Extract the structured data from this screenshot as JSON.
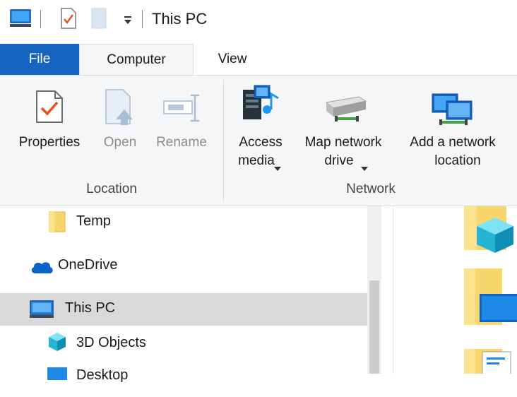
{
  "window": {
    "title": "This PC"
  },
  "quick_access": {
    "icons": [
      "computer-icon",
      "properties-icon",
      "new-folder-icon",
      "customize-dropdown-icon"
    ]
  },
  "tabs": [
    {
      "label": "File"
    },
    {
      "label": "Computer"
    },
    {
      "label": "View"
    }
  ],
  "ribbon": {
    "location_group": {
      "label": "Location",
      "properties": "Properties",
      "open": "Open",
      "rename": "Rename"
    },
    "network_group": {
      "label": "Network",
      "access_media_line1": "Access",
      "access_media_line2": "media",
      "map_drive_line1": "Map network",
      "map_drive_line2": "drive",
      "add_location_line1": "Add a network",
      "add_location_line2": "location"
    }
  },
  "nav": {
    "items": [
      {
        "label": "Temp",
        "icon": "folder-icon"
      },
      {
        "label": "OneDrive",
        "icon": "cloud-icon"
      },
      {
        "label": "This PC",
        "icon": "computer-icon",
        "selected": true
      },
      {
        "label": "3D Objects",
        "icon": "cube-icon"
      },
      {
        "label": "Desktop",
        "icon": "desktop-icon"
      }
    ]
  },
  "colors": {
    "file_tab": "#1565c0",
    "ribbon_bg": "#f5f6f7",
    "selected_bg": "#d9d9d9",
    "check_orange": "#e8501c"
  }
}
